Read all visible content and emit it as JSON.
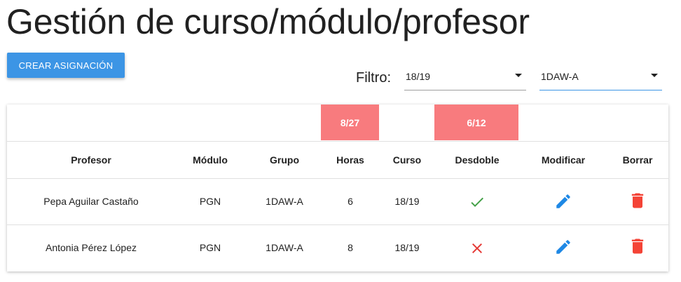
{
  "page": {
    "title": "Gestión de curso/módulo/profesor",
    "create_button_label": "CREAR ASIGNACIÓN"
  },
  "filter": {
    "label": "Filtro:",
    "year_value": "18/19",
    "group_value": "1DAW-A"
  },
  "summary": {
    "hours": "8/27",
    "split": "6/12"
  },
  "table": {
    "headers": {
      "teacher": "Profesor",
      "module": "Módulo",
      "group": "Grupo",
      "hours": "Horas",
      "course": "Curso",
      "split": "Desdoble",
      "edit": "Modificar",
      "delete": "Borrar"
    },
    "rows": [
      {
        "teacher": "Pepa Aguilar Castaño",
        "module": "PGN",
        "group": "1DAW-A",
        "hours": "6",
        "course": "18/19",
        "split": true,
        "split_icon": "check-icon",
        "edit_icon": "pencil-icon",
        "delete_icon": "trash-icon"
      },
      {
        "teacher": "Antonia Pérez López",
        "module": "PGN",
        "group": "1DAW-A",
        "hours": "8",
        "course": "18/19",
        "split": false,
        "split_icon": "close-icon",
        "edit_icon": "pencil-icon",
        "delete_icon": "trash-icon"
      }
    ]
  },
  "colors": {
    "primary": "#3c95e5",
    "badge": "#f87b7e",
    "check": "#43a047",
    "cross": "#e53935",
    "delete": "#f44336",
    "edit": "#1e88e5"
  }
}
